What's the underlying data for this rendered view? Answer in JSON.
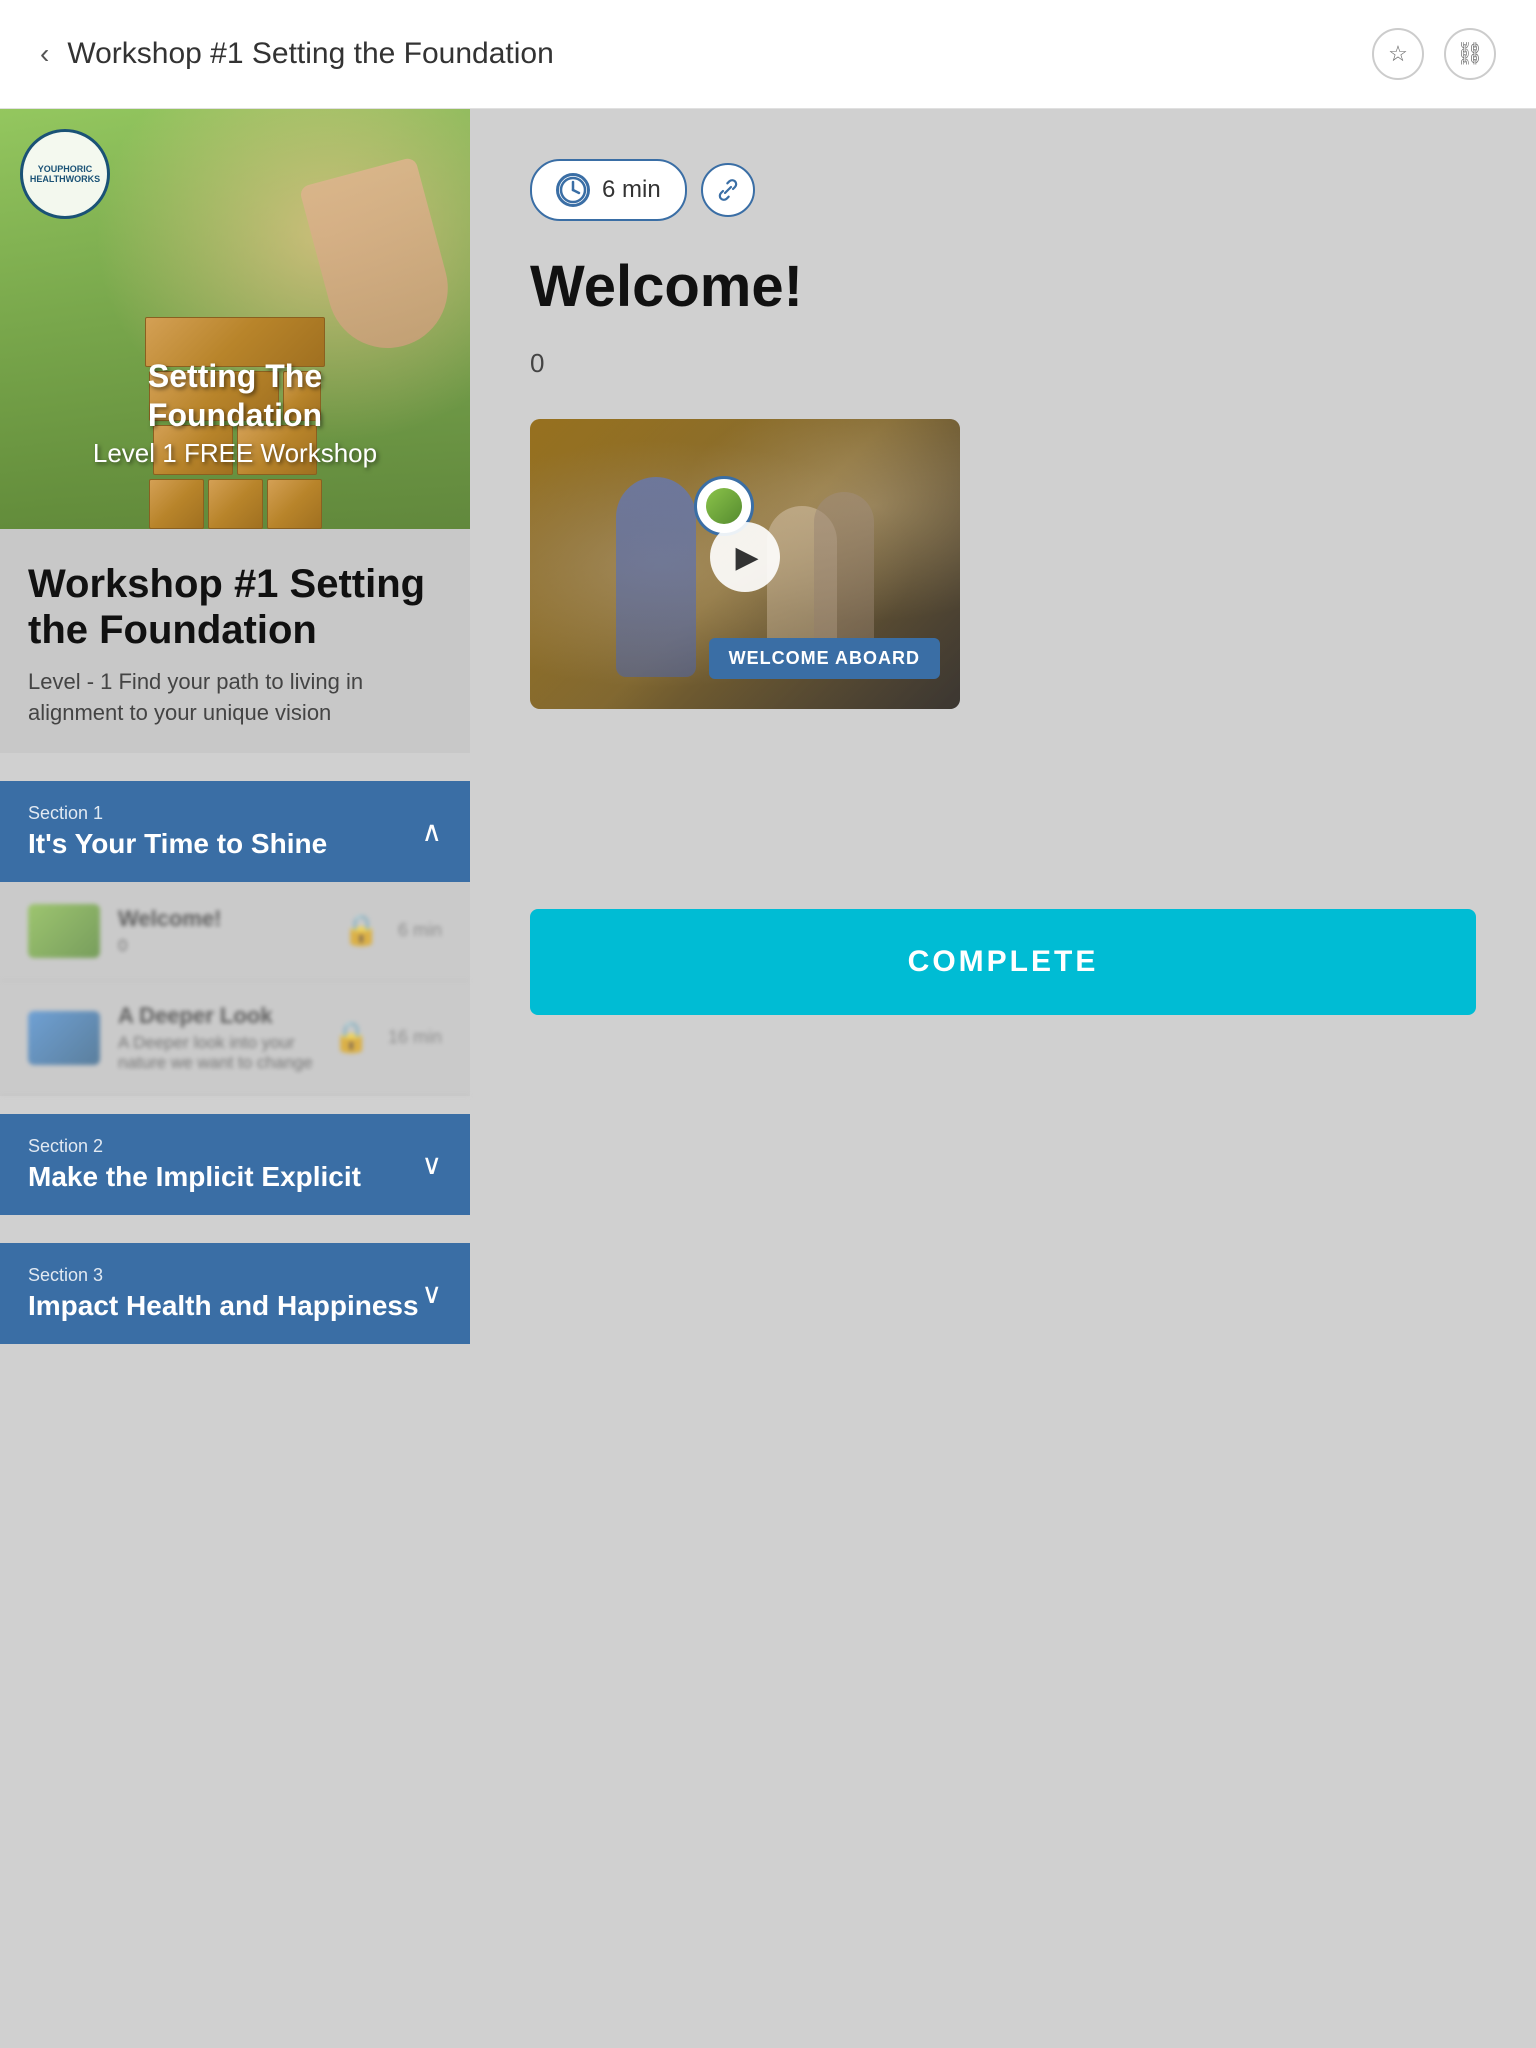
{
  "header": {
    "back_label": "Workshop #1 Setting the Foundation",
    "bookmark_icon": "☆",
    "share_icon": "⛓"
  },
  "hero": {
    "logo_text": "YOUPHORIC\nHEALTHWORKS",
    "title_line1": "Setting The",
    "title_line2": "Foundation",
    "subtitle": "Level 1 FREE Workshop"
  },
  "workshop": {
    "title": "Workshop #1 Setting the Foundation",
    "subtitle": "Level - 1 Find your path to living in alignment to your unique vision"
  },
  "sections": [
    {
      "number": "Section 1",
      "title": "It's Your Time to Shine",
      "expanded": true,
      "chevron": "∧",
      "lessons": [
        {
          "name": "Welcome!",
          "desc": "0",
          "duration": "6 min",
          "locked": true
        },
        {
          "name": "A Deeper Look",
          "desc": "A Deeper look into your nature we want to change",
          "duration": "16 min",
          "locked": true
        }
      ]
    },
    {
      "number": "Section 2",
      "title": "Make the Implicit Explicit",
      "expanded": false,
      "chevron": "∨"
    },
    {
      "number": "Section 3",
      "title": "Impact Health and Happiness",
      "expanded": false,
      "chevron": "∨"
    }
  ],
  "content": {
    "time_label": "6 min",
    "time_icon": "🕐",
    "link_icon": "⛓",
    "welcome_heading": "Welcome!",
    "content_text": "0",
    "video_banner": "WELCOME ABOARD",
    "play_icon": "▶"
  },
  "footer": {
    "complete_label": "COMPLETE"
  },
  "colors": {
    "accent_blue": "#3a6ea5",
    "cyan": "#00bcd4",
    "bg": "#d0d0d0",
    "white": "#ffffff"
  }
}
